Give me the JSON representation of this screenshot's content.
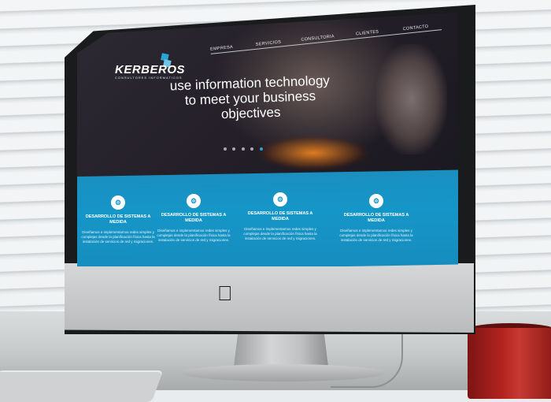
{
  "site": {
    "logo_text": "KERBEROS",
    "logo_sub": "CONSULTORES INFORMATICOS",
    "nav": [
      "EMPRESA",
      "SERVICIOS",
      "CONSULTORIA",
      "CLIENTES",
      "CONTACTO"
    ],
    "headline": "use information technology to meet your business objectives",
    "slider_dots": 5,
    "active_dot": 4,
    "features": [
      {
        "title": "DESARROLLO DE SISTEMAS A MEDIDA",
        "desc": "Diseñamos e implementamos redes simples y complejas desde la planificación física hasta la instalación de servicios de red y migraciones.",
        "icon": "gear-icon"
      },
      {
        "title": "DESARROLLO DE SISTEMAS A MEDIDA",
        "desc": "Diseñamos e implementamos redes simples y complejas desde la planificación física hasta la instalación de servicios de red y migraciones.",
        "icon": "gear-icon"
      },
      {
        "title": "DESARROLLO DE SISTEMAS A MEDIDA",
        "desc": "Diseñamos e implementamos redes simples y complejas desde la planificación física hasta la instalación de servicios de red y migraciones.",
        "icon": "gear-icon"
      },
      {
        "title": "DESARROLLO DE SISTEMAS A MEDIDA",
        "desc": "Diseñamos e implementamos redes simples y complejas desde la planificación física hasta la instalación de servicios de red y migraciones.",
        "icon": "gear-icon"
      }
    ],
    "accent_color": "#1596c8"
  }
}
